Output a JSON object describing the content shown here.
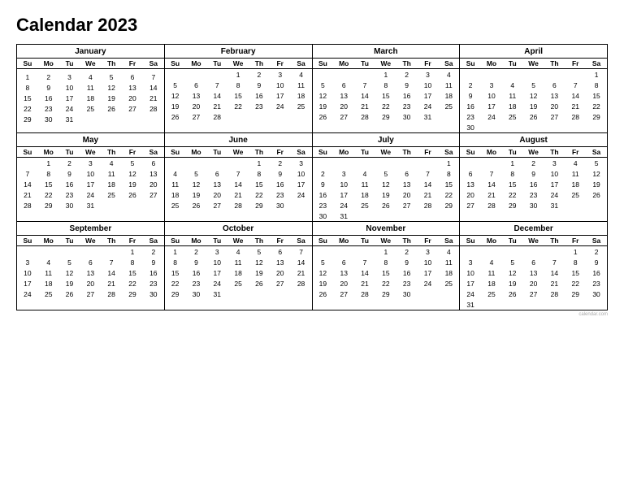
{
  "title": "Calendar 2023",
  "months": [
    {
      "name": "January",
      "days_header": [
        "Su",
        "Mo",
        "Tu",
        "We",
        "Th",
        "Fr",
        "Sa"
      ],
      "weeks": [
        [
          "",
          "",
          "",
          "",
          "",
          "",
          ""
        ],
        [
          "1",
          "2",
          "3",
          "4",
          "5",
          "6",
          "7"
        ],
        [
          "8",
          "9",
          "10",
          "11",
          "12",
          "13",
          "14"
        ],
        [
          "15",
          "16",
          "17",
          "18",
          "19",
          "20",
          "21"
        ],
        [
          "22",
          "23",
          "24",
          "25",
          "26",
          "27",
          "28"
        ],
        [
          "29",
          "30",
          "31",
          "",
          "",
          "",
          ""
        ]
      ]
    },
    {
      "name": "February",
      "days_header": [
        "Su",
        "Mo",
        "Tu",
        "We",
        "Th",
        "Fr",
        "Sa"
      ],
      "weeks": [
        [
          "",
          "",
          "",
          "1",
          "2",
          "3",
          "4"
        ],
        [
          "5",
          "6",
          "7",
          "8",
          "9",
          "10",
          "11"
        ],
        [
          "12",
          "13",
          "14",
          "15",
          "16",
          "17",
          "18"
        ],
        [
          "19",
          "20",
          "21",
          "22",
          "23",
          "24",
          "25"
        ],
        [
          "26",
          "27",
          "28",
          "",
          "",
          "",
          ""
        ],
        [
          "",
          "",
          "",
          "",
          "",
          "",
          ""
        ]
      ]
    },
    {
      "name": "March",
      "days_header": [
        "Su",
        "Mo",
        "Tu",
        "We",
        "Th",
        "Fr",
        "Sa"
      ],
      "weeks": [
        [
          "",
          "",
          "",
          "1",
          "2",
          "3",
          "4"
        ],
        [
          "5",
          "6",
          "7",
          "8",
          "9",
          "10",
          "11"
        ],
        [
          "12",
          "13",
          "14",
          "15",
          "16",
          "17",
          "18"
        ],
        [
          "19",
          "20",
          "21",
          "22",
          "23",
          "24",
          "25"
        ],
        [
          "26",
          "27",
          "28",
          "29",
          "30",
          "31",
          ""
        ],
        [
          "",
          "",
          "",
          "",
          "",
          "",
          ""
        ]
      ]
    },
    {
      "name": "April",
      "days_header": [
        "Su",
        "Mo",
        "Tu",
        "We",
        "Th",
        "Fr",
        "Sa"
      ],
      "weeks": [
        [
          "",
          "",
          "",
          "",
          "",
          "",
          "1"
        ],
        [
          "2",
          "3",
          "4",
          "5",
          "6",
          "7",
          "8"
        ],
        [
          "9",
          "10",
          "11",
          "12",
          "13",
          "14",
          "15"
        ],
        [
          "16",
          "17",
          "18",
          "19",
          "20",
          "21",
          "22"
        ],
        [
          "23",
          "24",
          "25",
          "26",
          "27",
          "28",
          "29"
        ],
        [
          "30",
          "",
          "",
          "",
          "",
          "",
          ""
        ]
      ]
    },
    {
      "name": "May",
      "days_header": [
        "Su",
        "Mo",
        "Tu",
        "We",
        "Th",
        "Fr",
        "Sa"
      ],
      "weeks": [
        [
          "",
          "1",
          "2",
          "3",
          "4",
          "5",
          "6"
        ],
        [
          "7",
          "8",
          "9",
          "10",
          "11",
          "12",
          "13"
        ],
        [
          "14",
          "15",
          "16",
          "17",
          "18",
          "19",
          "20"
        ],
        [
          "21",
          "22",
          "23",
          "24",
          "25",
          "26",
          "27"
        ],
        [
          "28",
          "29",
          "30",
          "31",
          "",
          "",
          ""
        ],
        [
          "",
          "",
          "",
          "",
          "",
          "",
          ""
        ]
      ]
    },
    {
      "name": "June",
      "days_header": [
        "Su",
        "Mo",
        "Tu",
        "We",
        "Th",
        "Fr",
        "Sa"
      ],
      "weeks": [
        [
          "",
          "",
          "",
          "",
          "1",
          "2",
          "3"
        ],
        [
          "4",
          "5",
          "6",
          "7",
          "8",
          "9",
          "10"
        ],
        [
          "11",
          "12",
          "13",
          "14",
          "15",
          "16",
          "17"
        ],
        [
          "18",
          "19",
          "20",
          "21",
          "22",
          "23",
          "24"
        ],
        [
          "25",
          "26",
          "27",
          "28",
          "29",
          "30",
          ""
        ],
        [
          "",
          "",
          "",
          "",
          "",
          "",
          ""
        ]
      ]
    },
    {
      "name": "July",
      "days_header": [
        "Su",
        "Mo",
        "Tu",
        "We",
        "Th",
        "Fr",
        "Sa"
      ],
      "weeks": [
        [
          "",
          "",
          "",
          "",
          "",
          "",
          "1"
        ],
        [
          "2",
          "3",
          "4",
          "5",
          "6",
          "7",
          "8"
        ],
        [
          "9",
          "10",
          "11",
          "12",
          "13",
          "14",
          "15"
        ],
        [
          "16",
          "17",
          "18",
          "19",
          "20",
          "21",
          "22"
        ],
        [
          "23",
          "24",
          "25",
          "26",
          "27",
          "28",
          "29"
        ],
        [
          "30",
          "31",
          "",
          "",
          "",
          "",
          ""
        ]
      ]
    },
    {
      "name": "August",
      "days_header": [
        "Su",
        "Mo",
        "Tu",
        "We",
        "Th",
        "Fr",
        "Sa"
      ],
      "weeks": [
        [
          "",
          "",
          "1",
          "2",
          "3",
          "4",
          "5"
        ],
        [
          "6",
          "7",
          "8",
          "9",
          "10",
          "11",
          "12"
        ],
        [
          "13",
          "14",
          "15",
          "16",
          "17",
          "18",
          "19"
        ],
        [
          "20",
          "21",
          "22",
          "23",
          "24",
          "25",
          "26"
        ],
        [
          "27",
          "28",
          "29",
          "30",
          "31",
          "",
          ""
        ],
        [
          "",
          "",
          "",
          "",
          "",
          "",
          ""
        ]
      ]
    },
    {
      "name": "September",
      "days_header": [
        "Su",
        "Mo",
        "Tu",
        "We",
        "Th",
        "Fr",
        "Sa"
      ],
      "weeks": [
        [
          "",
          "",
          "",
          "",
          "",
          "1",
          "2"
        ],
        [
          "3",
          "4",
          "5",
          "6",
          "7",
          "8",
          "9"
        ],
        [
          "10",
          "11",
          "12",
          "13",
          "14",
          "15",
          "16"
        ],
        [
          "17",
          "18",
          "19",
          "20",
          "21",
          "22",
          "23"
        ],
        [
          "24",
          "25",
          "26",
          "27",
          "28",
          "29",
          "30"
        ],
        [
          "",
          "",
          "",
          "",
          "",
          "",
          ""
        ]
      ]
    },
    {
      "name": "October",
      "days_header": [
        "Su",
        "Mo",
        "Tu",
        "We",
        "Th",
        "Fr",
        "Sa"
      ],
      "weeks": [
        [
          "1",
          "2",
          "3",
          "4",
          "5",
          "6",
          "7"
        ],
        [
          "8",
          "9",
          "10",
          "11",
          "12",
          "13",
          "14"
        ],
        [
          "15",
          "16",
          "17",
          "18",
          "19",
          "20",
          "21"
        ],
        [
          "22",
          "23",
          "24",
          "25",
          "26",
          "27",
          "28"
        ],
        [
          "29",
          "30",
          "31",
          "",
          "",
          "",
          ""
        ],
        [
          "",
          "",
          "",
          "",
          "",
          "",
          ""
        ]
      ]
    },
    {
      "name": "November",
      "days_header": [
        "Su",
        "Mo",
        "Tu",
        "We",
        "Th",
        "Fr",
        "Sa"
      ],
      "weeks": [
        [
          "",
          "",
          "",
          "1",
          "2",
          "3",
          "4"
        ],
        [
          "5",
          "6",
          "7",
          "8",
          "9",
          "10",
          "11"
        ],
        [
          "12",
          "13",
          "14",
          "15",
          "16",
          "17",
          "18"
        ],
        [
          "19",
          "20",
          "21",
          "22",
          "23",
          "24",
          "25"
        ],
        [
          "26",
          "27",
          "28",
          "29",
          "30",
          "",
          ""
        ],
        [
          "",
          "",
          "",
          "",
          "",
          "",
          ""
        ]
      ]
    },
    {
      "name": "December",
      "days_header": [
        "Su",
        "Mo",
        "Tu",
        "We",
        "Th",
        "Fr",
        "Sa"
      ],
      "weeks": [
        [
          "",
          "",
          "",
          "",
          "",
          "1",
          "2"
        ],
        [
          "3",
          "4",
          "5",
          "6",
          "7",
          "8",
          "9"
        ],
        [
          "10",
          "11",
          "12",
          "13",
          "14",
          "15",
          "16"
        ],
        [
          "17",
          "18",
          "19",
          "20",
          "21",
          "22",
          "23"
        ],
        [
          "24",
          "25",
          "26",
          "27",
          "28",
          "29",
          "30"
        ],
        [
          "31",
          "",
          "",
          "",
          "",
          "",
          ""
        ]
      ]
    }
  ],
  "watermark": "calendar.com"
}
